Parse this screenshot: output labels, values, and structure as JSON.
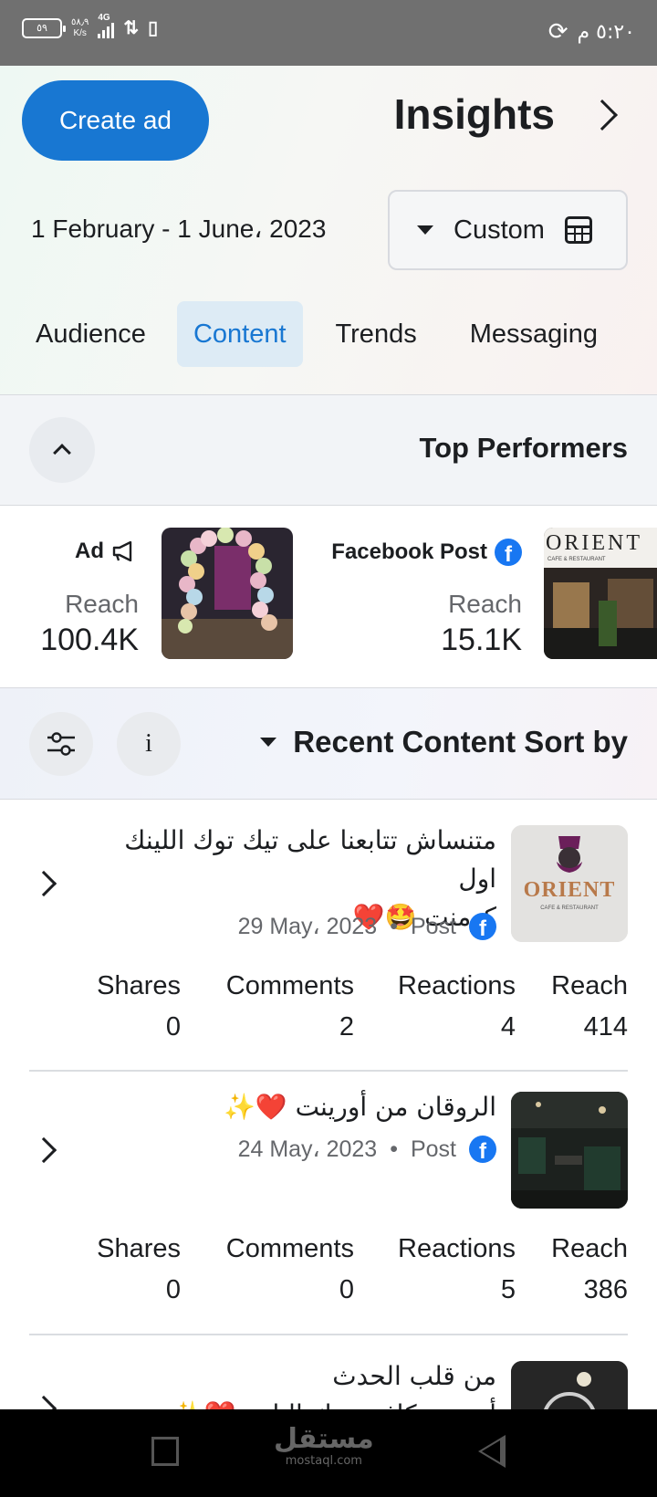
{
  "status_bar": {
    "battery": "٥٩",
    "speed_value": "٥٨٫٩",
    "speed_unit": "K/s",
    "network": "4G",
    "time": "٥:٢٠ م"
  },
  "header": {
    "create_ad_label": "Create ad",
    "title": "Insights"
  },
  "date_filter": {
    "range": "1 February - 1 June، 2023",
    "preset_label": "Custom"
  },
  "tabs": [
    {
      "label": "Audience"
    },
    {
      "label": "Content",
      "active": true
    },
    {
      "label": "Trends"
    },
    {
      "label": "Messaging"
    }
  ],
  "top_performers": {
    "title": "Top Performers",
    "items": [
      {
        "type_label": "Ad",
        "icon": "megaphone-icon",
        "reach_label": "Reach",
        "reach_value": "100.4K"
      },
      {
        "type_label": "Facebook Post",
        "icon": "facebook-icon",
        "reach_label": "Reach",
        "reach_value": "15.1K"
      }
    ],
    "orient_sign": "ORIENT",
    "orient_sign_sub": "CAFE & RESTAURANT"
  },
  "recent_content": {
    "title": "Recent Content Sort by",
    "info_label": "i",
    "posts": [
      {
        "text_line1": "متنساش تتابعنا على تيك توك اللينك اول",
        "text_line2": "كومنت 🤩❤️",
        "date": "29 May، 2023",
        "separator": "•",
        "type": "Post",
        "logo_text": "ORIENT",
        "logo_sub": "CAFE & RESTAURANT",
        "metrics": [
          {
            "label": "Shares",
            "value": "0"
          },
          {
            "label": "Comments",
            "value": "2"
          },
          {
            "label": "Reactions",
            "value": "4"
          },
          {
            "label": "Reach",
            "value": "414"
          }
        ]
      },
      {
        "text_line1": "الروقان من أورينت ❤️✨",
        "date": "24 May، 2023",
        "separator": "•",
        "type": "Post",
        "metrics": [
          {
            "label": "Shares",
            "value": "0"
          },
          {
            "label": "Comments",
            "value": "0"
          },
          {
            "label": "Reactions",
            "value": "5"
          },
          {
            "label": "Reach",
            "value": "386"
          }
        ]
      },
      {
        "text_line1": "من قلب الحدث",
        "text_line2": "أورينت كافيه بيتك التاني ❤️✨"
      }
    ]
  },
  "watermark": {
    "arabic": "مستقل",
    "latin": "mostaql.com"
  },
  "colors": {
    "accent": "#1877d2",
    "facebook": "#1877f2",
    "status_bar": "#707070"
  }
}
